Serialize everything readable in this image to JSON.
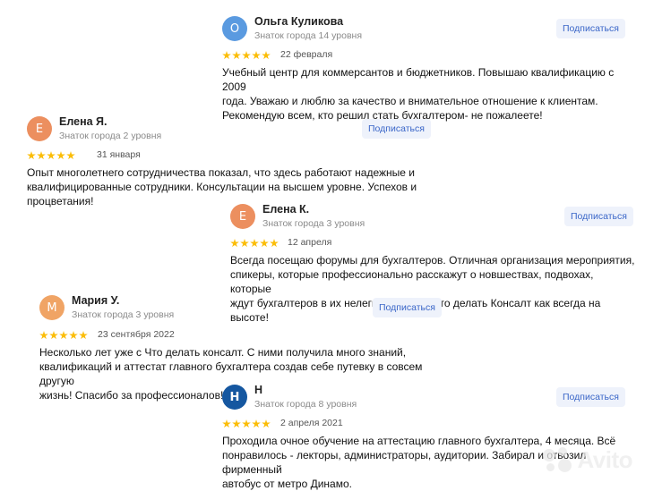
{
  "subscribe_label": "Подписаться",
  "reviews": [
    {
      "initial": "О",
      "avatar_color": "#5a9ae0",
      "name": "Ольга Куликова",
      "badge": "Знаток города 14 уровня",
      "rating": 5,
      "date": "22 февраля",
      "lines": [
        "Учебный центр для коммерсантов и бюджетников. Повышаю квалификацию с 2009",
        "года. Уважаю и люблю за качество и внимательное отношение к клиентам.",
        "Рекомендую всем, кто решил стать бухгалтером- не пожалеете!"
      ]
    },
    {
      "initial": "Е",
      "avatar_color": "#ec8f5f",
      "name": "Елена Я.",
      "badge": "Знаток города 2 уровня",
      "rating": 5,
      "date": "31 января",
      "lines": [
        "Опыт многолетнего сотрудничества показал, что здесь работают надежные и",
        "квалифицированные сотрудники. Консультации на высшем уровне. Успехов и",
        "процветания!"
      ]
    },
    {
      "initial": "Е",
      "avatar_color": "#ec8f5f",
      "name": "Елена К.",
      "badge": "Знаток города 3 уровня",
      "rating": 5,
      "date": "12 апреля",
      "lines": [
        "Всегда посещаю форумы для бухгалтеров. Отличная организация мероприятия,",
        "спикеры, которые профессионально расскажут о новшествах, подвохах, которые",
        "ждут бухгалтеров в их нелегкой работе. Что делать Консалт как всегда на высоте!"
      ]
    },
    {
      "initial": "М",
      "avatar_color": "#f0a465",
      "name": "Мария У.",
      "badge": "Знаток города 3 уровня",
      "rating": 5,
      "date": "23 сентября 2022",
      "lines": [
        "Несколько лет уже с Что делать консалт. С ними получила много знаний,",
        "квалификаций и аттестат главного бухгалтера создав себе путевку в совсем другую",
        "жизнь! Спасибо за профессионалов!"
      ]
    },
    {
      "initial": "Н",
      "avatar_color": "#1557a0",
      "name": "Н",
      "badge": "Знаток города 8 уровня",
      "rating": 5,
      "date": "2 апреля 2021",
      "lines": [
        "Проходила очное обучение на аттестацию главного бухгалтера, 4 месяца. Всё",
        "понравилось - лекторы, администраторы, аудитории. Забирал и отвозил фирменный",
        "автобус от метро Динамо."
      ]
    }
  ],
  "watermark": "Avito"
}
